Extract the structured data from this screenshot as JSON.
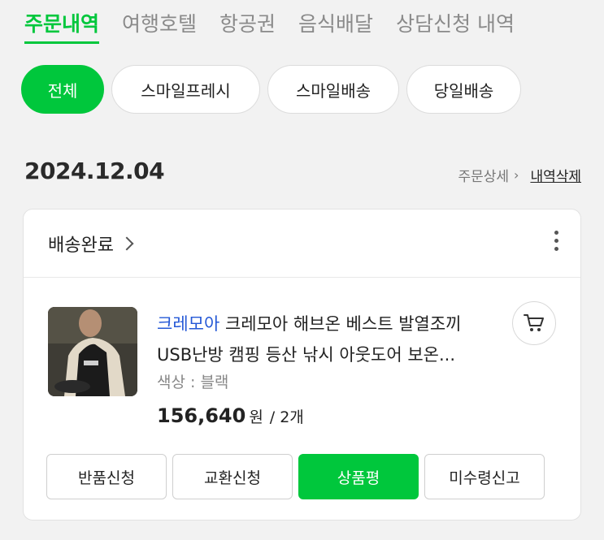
{
  "top_tabs": [
    "주문내역",
    "여행호텔",
    "항공권",
    "음식배달",
    "상담신청 내역"
  ],
  "chips": [
    "전체",
    "스마일프레시",
    "스마일배송",
    "당일배송"
  ],
  "order": {
    "date": "2024.12.04",
    "detail_link": "주문상세",
    "delete_link": "내역삭제",
    "status": "배송완료",
    "brand": "크레모아",
    "title_line1": "크레모아 해브온 베스트 발열조끼",
    "title_line2": "USB난방 캠핑 등산 낚시 아웃도어 보온...",
    "option": "색상 : 블랙",
    "price": "156,640",
    "currency": "원",
    "quantity": "2개",
    "actions": [
      "반품신청",
      "교환신청",
      "상품평",
      "미수령신고"
    ]
  },
  "colors": {
    "accent": "#00c73c",
    "brand_link": "#2458d6"
  },
  "icons": {
    "more": "more-vertical-icon",
    "cart": "cart-icon",
    "chevron": "chevron-right-icon"
  }
}
